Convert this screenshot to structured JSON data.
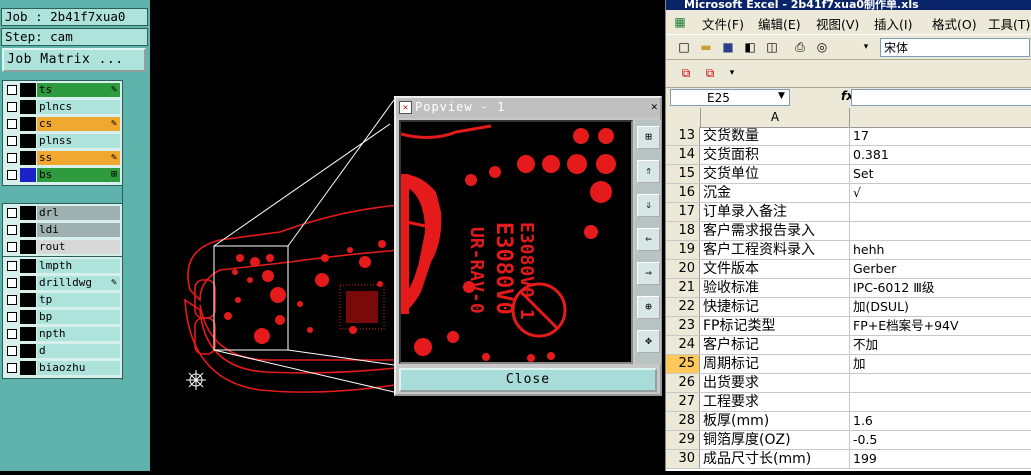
{
  "cam": {
    "job_label": "Job : 2b41f7xua0",
    "step_label": "Step: cam",
    "job_matrix_label": "Job Matrix ...",
    "layer_groups": [
      [
        {
          "name": "ts",
          "color": "#2e9b3e",
          "edit": true
        },
        {
          "name": "plncs",
          "color": "#000000",
          "edit": false
        },
        {
          "name": "cs",
          "color": "#f0a830",
          "edit": true
        },
        {
          "name": "plnss",
          "color": "#000000",
          "edit": false
        },
        {
          "name": "ss",
          "color": "#f0a830",
          "edit": true
        },
        {
          "name": "bs",
          "color": "#2e9b3e",
          "edit": true,
          "active": true
        }
      ],
      [
        {
          "name": "drl",
          "color": "#000000",
          "edit": false,
          "grey": true
        },
        {
          "name": "ldi",
          "color": "#000000",
          "edit": false,
          "grey": true
        },
        {
          "name": "rout",
          "color": "#000000",
          "edit": false,
          "grey": true
        }
      ],
      [
        {
          "name": "lmpth",
          "color": "#000000",
          "edit": false
        },
        {
          "name": "drilldwg",
          "color": "#000000",
          "edit": true
        },
        {
          "name": "tp",
          "color": "#000000",
          "edit": false
        },
        {
          "name": "bp",
          "color": "#000000",
          "edit": false
        },
        {
          "name": "npth",
          "color": "#000000",
          "edit": false
        },
        {
          "name": "d",
          "color": "#000000",
          "edit": false
        },
        {
          "name": "biaozhu",
          "color": "#000000",
          "edit": false
        }
      ]
    ]
  },
  "popview": {
    "title": "Popview - 1",
    "close_label": "Close",
    "tools": [
      "zoom-fit-icon",
      "pan-up-icon",
      "pan-down-icon",
      "pan-left-icon",
      "pan-right-icon",
      "zoom-in-icon",
      "move-icon"
    ],
    "pcb_text": [
      "E3080V0",
      "UR-RAV-0",
      "E3080V0 1"
    ]
  },
  "excel": {
    "title": "Microsoft Excel - 2b41f7xua0制作单.xls",
    "menus": [
      "文件(F)",
      "编辑(E)",
      "视图(V)",
      "插入(I)",
      "格式(O)",
      "工具(T)"
    ],
    "font_name": "宋体",
    "name_box": "E25",
    "fx_label": "fx",
    "column_a": "A",
    "rows": [
      {
        "n": "13",
        "a": "交货数量",
        "b": "17"
      },
      {
        "n": "14",
        "a": "交货面积",
        "b": "0.381"
      },
      {
        "n": "15",
        "a": "交货单位",
        "b": "Set"
      },
      {
        "n": "16",
        "a": "沉金",
        "b": "√"
      },
      {
        "n": "17",
        "a": "订单录入备注",
        "b": ""
      },
      {
        "n": "18",
        "a": "客户需求报告录入",
        "b": ""
      },
      {
        "n": "19",
        "a": "客户工程资料录入",
        "b": "hehh"
      },
      {
        "n": "20",
        "a": "文件版本",
        "b": "Gerber"
      },
      {
        "n": "21",
        "a": "验收标准",
        "b": "IPC-6012 Ⅲ级"
      },
      {
        "n": "22",
        "a": "快捷标记",
        "b": "加(DSUL)"
      },
      {
        "n": "23",
        "a": "FP标记类型",
        "b": "FP+E档案号+94V"
      },
      {
        "n": "24",
        "a": "客户标记",
        "b": "不加"
      },
      {
        "n": "25",
        "a": "周期标记",
        "b": "加",
        "selected": true
      },
      {
        "n": "26",
        "a": "出货要求",
        "b": ""
      },
      {
        "n": "27",
        "a": "工程要求",
        "b": ""
      },
      {
        "n": "28",
        "a": "板厚(mm)",
        "b": "1.6"
      },
      {
        "n": "29",
        "a": "铜箔厚度(OZ)",
        "b": "-0.5"
      },
      {
        "n": "30",
        "a": "成品尺寸长(mm)",
        "b": "199"
      }
    ]
  }
}
